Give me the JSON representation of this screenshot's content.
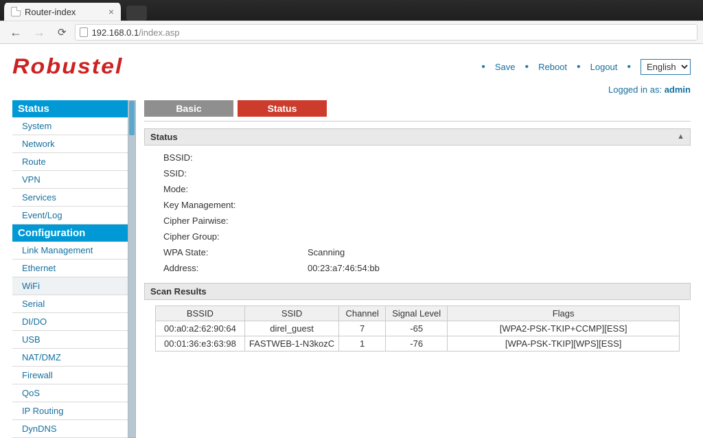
{
  "browser": {
    "tab_title": "Router-index",
    "url_host": "192.168.0.1",
    "url_path": "/index.asp"
  },
  "brand": "Robustel",
  "toplinks": {
    "save": "Save",
    "reboot": "Reboot",
    "logout": "Logout"
  },
  "language": {
    "selected": "English"
  },
  "logged_in": {
    "prefix": "Logged in as:",
    "user": "admin"
  },
  "sidebar": {
    "status_header": "Status",
    "status_items": [
      "System",
      "Network",
      "Route",
      "VPN",
      "Services",
      "Event/Log"
    ],
    "config_header": "Configuration",
    "config_items": [
      "Link Management",
      "Ethernet",
      "WiFi",
      "Serial",
      "DI/DO",
      "USB",
      "NAT/DMZ",
      "Firewall",
      "QoS",
      "IP Routing",
      "DynDNS"
    ]
  },
  "tabs": {
    "basic": "Basic",
    "status": "Status"
  },
  "status_panel": {
    "title": "Status",
    "rows": [
      {
        "k": "BSSID:",
        "v": ""
      },
      {
        "k": "SSID:",
        "v": ""
      },
      {
        "k": "Mode:",
        "v": ""
      },
      {
        "k": "Key Management:",
        "v": ""
      },
      {
        "k": "Cipher Pairwise:",
        "v": ""
      },
      {
        "k": "Cipher Group:",
        "v": ""
      },
      {
        "k": "WPA State:",
        "v": "Scanning"
      },
      {
        "k": "Address:",
        "v": "00:23:a7:46:54:bb"
      }
    ]
  },
  "scan_panel": {
    "title": "Scan Results",
    "headers": [
      "BSSID",
      "SSID",
      "Channel",
      "Signal Level",
      "Flags"
    ],
    "rows": [
      {
        "bssid": "00:a0:a2:62:90:64",
        "ssid": "direl_guest",
        "channel": "7",
        "signal": "-65",
        "flags": "[WPA2-PSK-TKIP+CCMP][ESS]"
      },
      {
        "bssid": "00:01:36:e3:63:98",
        "ssid": "FASTWEB-1-N3kozC",
        "channel": "1",
        "signal": "-76",
        "flags": "[WPA-PSK-TKIP][WPS][ESS]"
      }
    ]
  }
}
